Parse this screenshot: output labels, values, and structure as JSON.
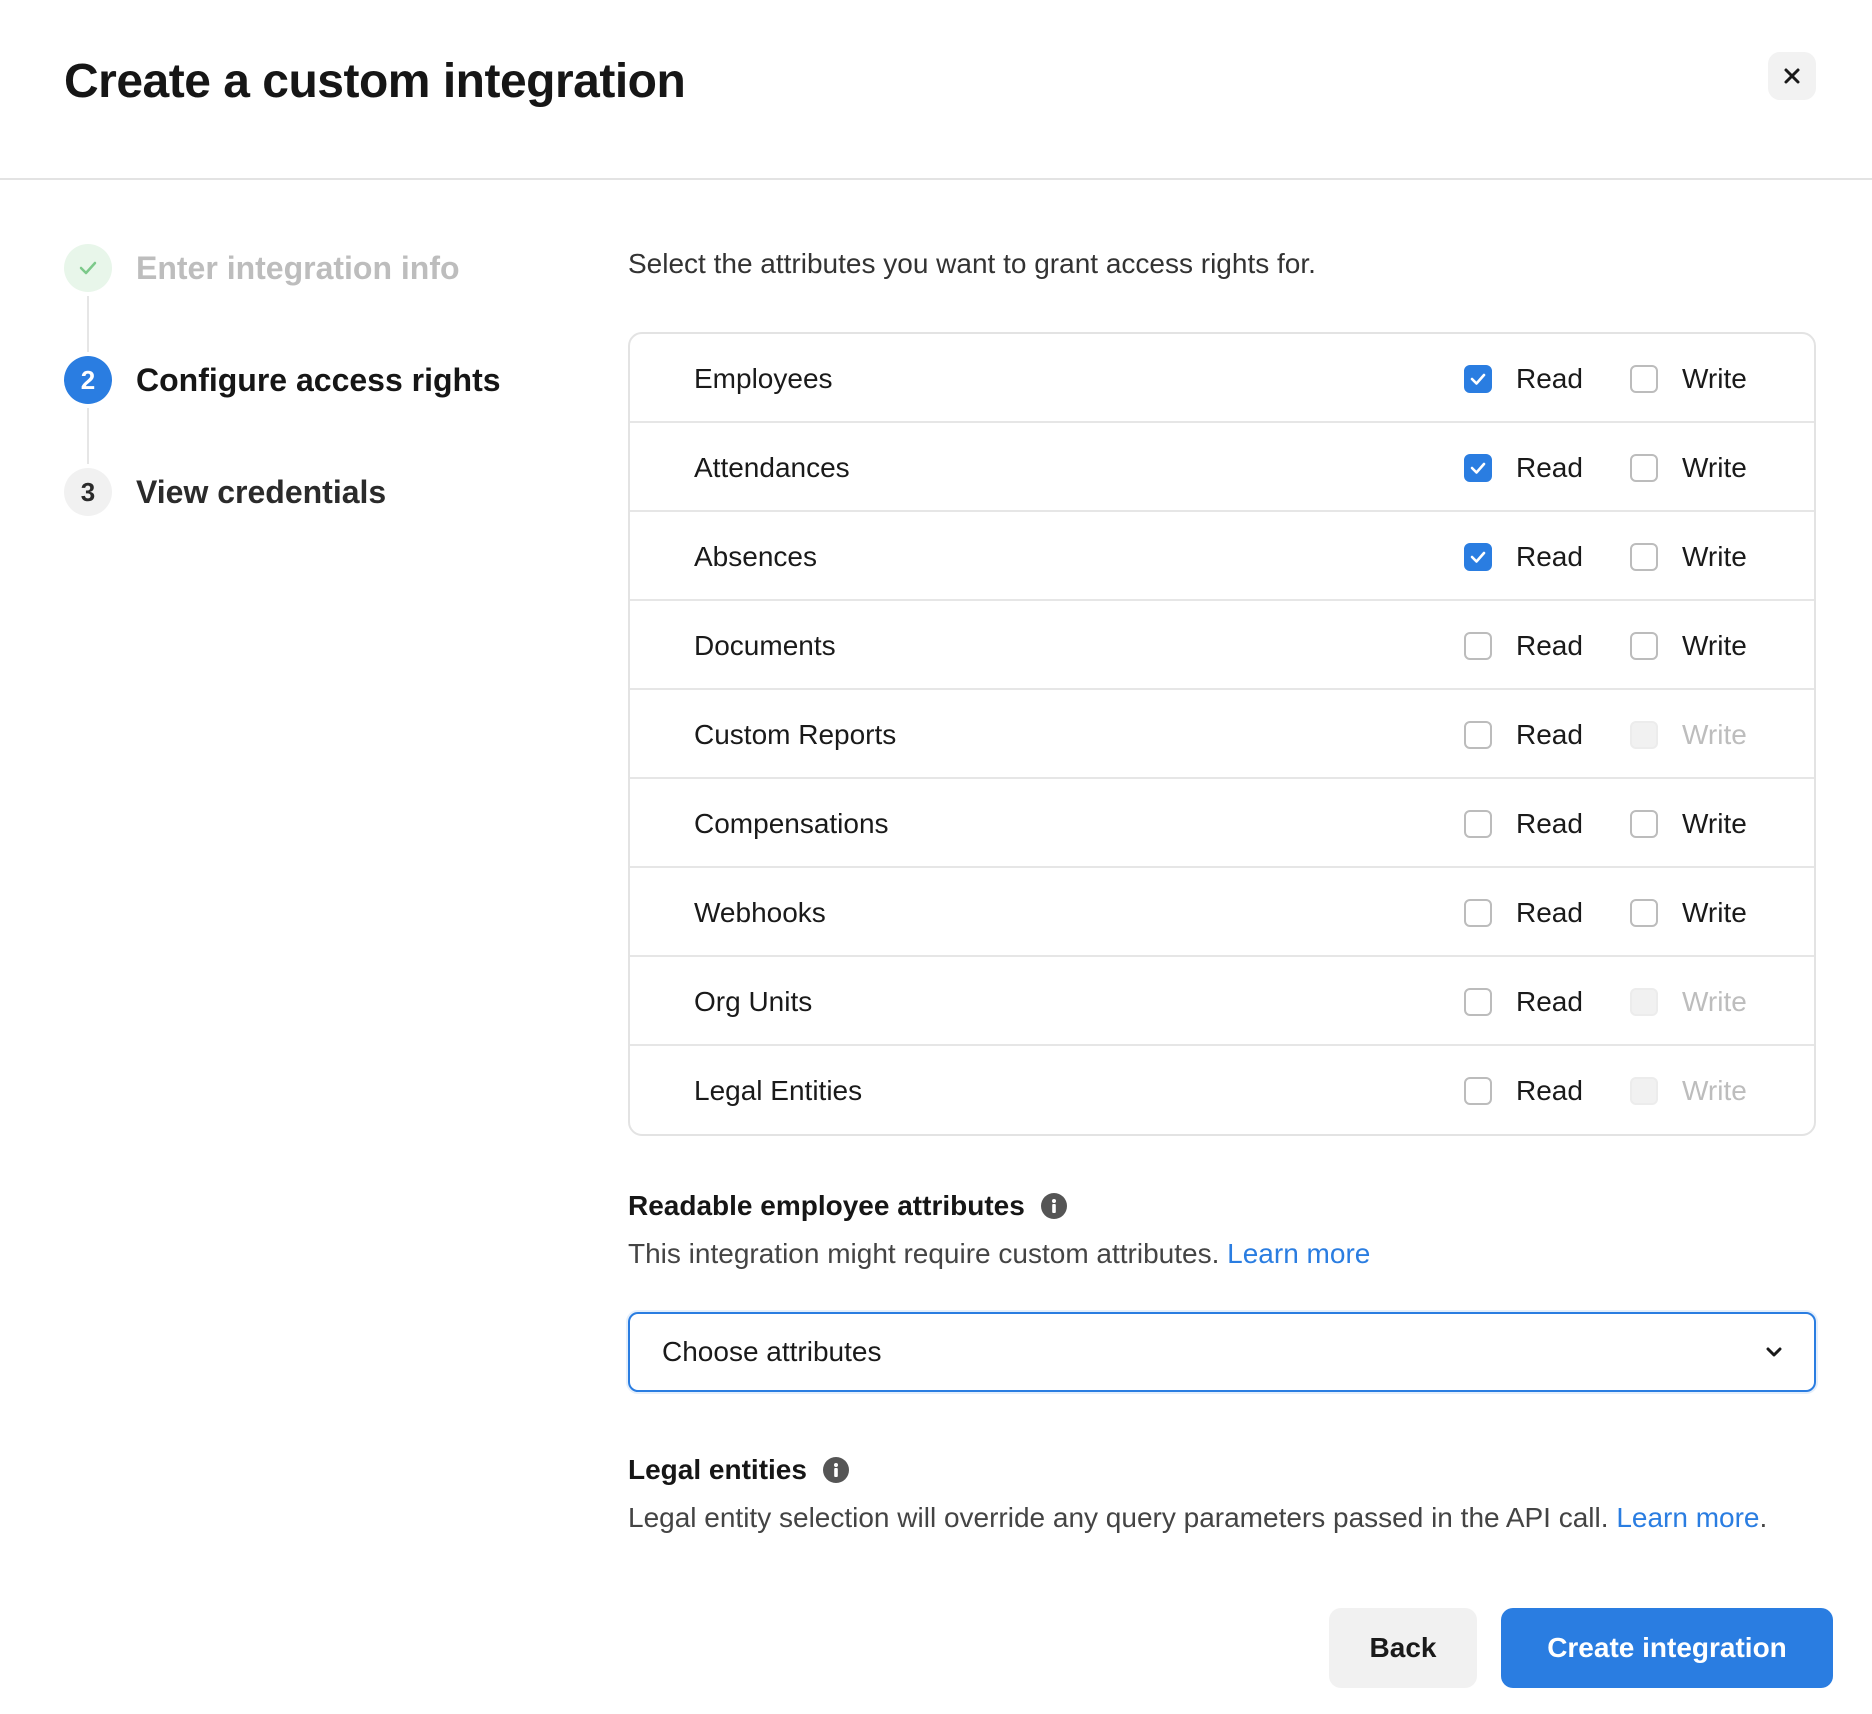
{
  "dialog": {
    "title": "Create a custom integration",
    "close_icon": "close-icon"
  },
  "steps": [
    {
      "number": "",
      "label": "Enter integration info",
      "status": "completed",
      "icon": "check-icon"
    },
    {
      "number": "2",
      "label": "Configure access rights",
      "status": "active"
    },
    {
      "number": "3",
      "label": "View credentials",
      "status": "upcoming"
    }
  ],
  "access": {
    "intro": "Select the attributes you want to grant access rights for.",
    "read_label": "Read",
    "write_label": "Write",
    "rows": [
      {
        "name": "Employees",
        "read": true,
        "write": false,
        "write_disabled": false
      },
      {
        "name": "Attendances",
        "read": true,
        "write": false,
        "write_disabled": false
      },
      {
        "name": "Absences",
        "read": true,
        "write": false,
        "write_disabled": false
      },
      {
        "name": "Documents",
        "read": false,
        "write": false,
        "write_disabled": false
      },
      {
        "name": "Custom Reports",
        "read": false,
        "write": false,
        "write_disabled": true
      },
      {
        "name": "Compensations",
        "read": false,
        "write": false,
        "write_disabled": false
      },
      {
        "name": "Webhooks",
        "read": false,
        "write": false,
        "write_disabled": false
      },
      {
        "name": "Org Units",
        "read": false,
        "write": false,
        "write_disabled": true
      },
      {
        "name": "Legal Entities",
        "read": false,
        "write": false,
        "write_disabled": true
      }
    ]
  },
  "readable_attributes": {
    "title": "Readable employee attributes",
    "description": "This integration might require custom attributes. ",
    "link": "Learn more",
    "select_value": "Choose attributes"
  },
  "legal_entities": {
    "title": "Legal entities",
    "description": "Legal entity selection will override any query parameters passed in the API call. ",
    "link": "Learn more",
    "suffix": "."
  },
  "footer": {
    "back_label": "Back",
    "create_label": "Create integration"
  },
  "colors": {
    "accent": "#2a7de1",
    "completed": "#e8f6ea",
    "check": "#7cc98a"
  }
}
